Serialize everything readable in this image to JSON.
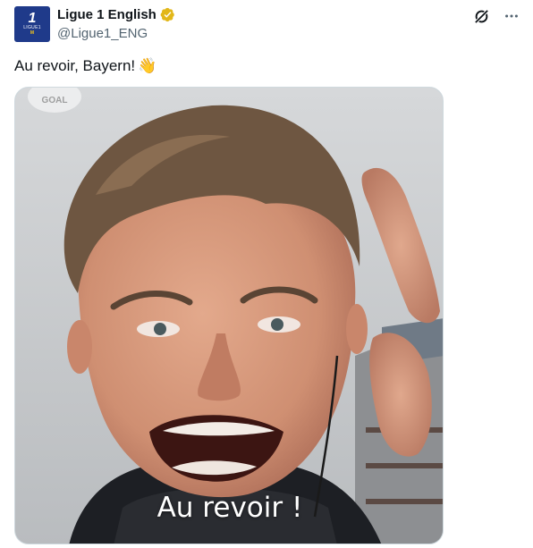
{
  "author": {
    "display_name": "Ligue 1 English",
    "handle": "@Ligue1_ENG",
    "avatar": {
      "mark": "1",
      "brand": "LIGUE1",
      "sub": "M"
    }
  },
  "post": {
    "text": "Au revoir, Bayern!",
    "emoji": "👋"
  },
  "media": {
    "caption": "Au revoir !",
    "channel_logo": "GOAL"
  },
  "icons": {
    "verified": "verified-badge-icon",
    "grok": "grok-icon",
    "more": "more-icon"
  },
  "colors": {
    "verified_gold": "#e2b719",
    "avatar_bg": "#1f3a8a",
    "text_primary": "#0f1419",
    "text_secondary": "#536471"
  }
}
